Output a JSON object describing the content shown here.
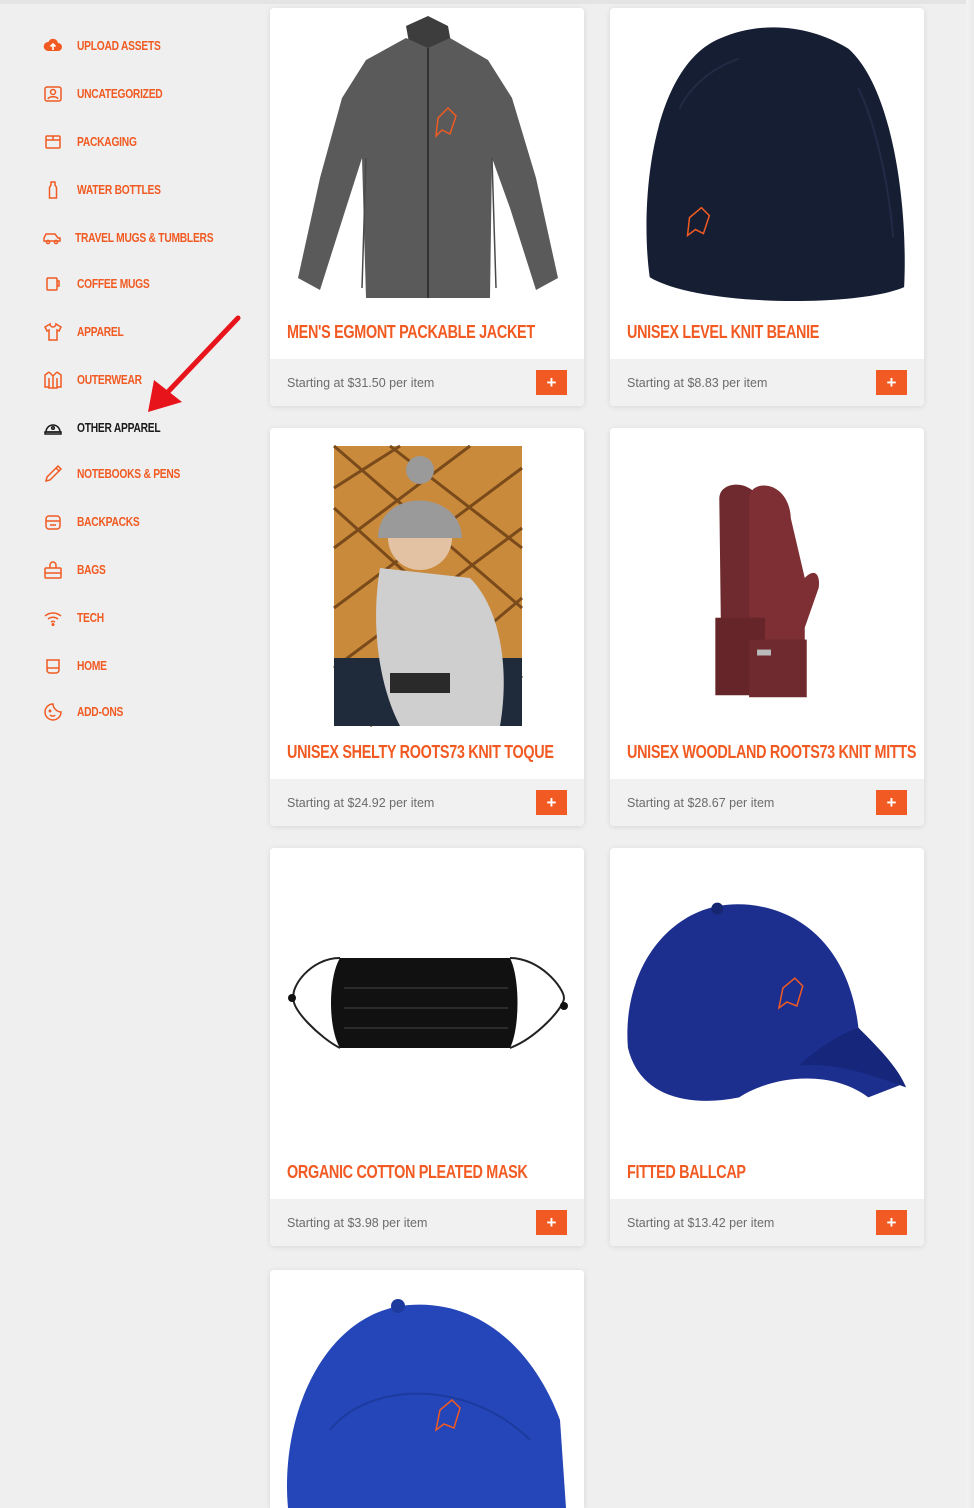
{
  "sidebar": {
    "items": [
      {
        "label": "Upload Assets",
        "icon": "cloud-upload-icon",
        "active": false
      },
      {
        "label": "Uncategorized",
        "icon": "person-badge-icon",
        "active": false
      },
      {
        "label": "Packaging",
        "icon": "box-icon",
        "active": false
      },
      {
        "label": "Water Bottles",
        "icon": "bottle-icon",
        "active": false
      },
      {
        "label": "Travel Mugs & Tumblers",
        "icon": "car-icon",
        "active": false
      },
      {
        "label": "Coffee Mugs",
        "icon": "mug-icon",
        "active": false
      },
      {
        "label": "Apparel",
        "icon": "tshirt-icon",
        "active": false
      },
      {
        "label": "Outerwear",
        "icon": "jacket-icon",
        "active": false
      },
      {
        "label": "Other Apparel",
        "icon": "cap-icon",
        "active": true
      },
      {
        "label": "Notebooks & Pens",
        "icon": "pen-icon",
        "active": false
      },
      {
        "label": "Backpacks",
        "icon": "backpack-icon",
        "active": false
      },
      {
        "label": "Bags",
        "icon": "bag-icon",
        "active": false
      },
      {
        "label": "Tech",
        "icon": "wifi-icon",
        "active": false
      },
      {
        "label": "Home",
        "icon": "home-bowl-icon",
        "active": false
      },
      {
        "label": "Add-Ons",
        "icon": "smile-sticker-icon",
        "active": false
      }
    ]
  },
  "products": [
    {
      "title": "Men's Egmont Packable Jacket",
      "price": "Starting at $31.50 per item",
      "button": "+"
    },
    {
      "title": "Unisex Level Knit Beanie",
      "price": "Starting at $8.83 per item",
      "button": "+"
    },
    {
      "title": "Unisex Shelty Roots73 Knit Toque",
      "price": "Starting at $24.92 per item",
      "button": "+"
    },
    {
      "title": "Unisex Woodland Roots73 Knit Mitts",
      "price": "Starting at $28.67 per item",
      "button": "+"
    },
    {
      "title": "Organic Cotton Pleated Mask",
      "price": "Starting at $3.98 per item",
      "button": "+"
    },
    {
      "title": "Fitted Ballcap",
      "price": "Starting at $13.42 per item",
      "button": "+"
    },
    {
      "title": "",
      "price": "",
      "button": ""
    }
  ],
  "colors": {
    "accent": "#f15a22",
    "active": "#1a1a1a",
    "annotation_arrow": "#e8141c"
  }
}
